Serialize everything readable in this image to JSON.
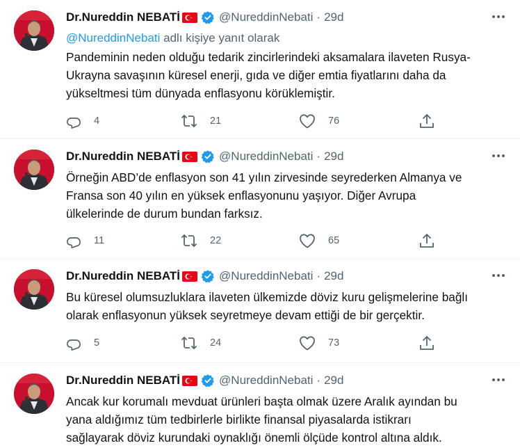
{
  "tweets": [
    {
      "author": "Dr.Nureddin NEBATİ",
      "handle": "@NureddinNebati",
      "separator": "·",
      "time": "29d",
      "reply_prefix": "@NureddinNebati",
      "reply_suffix": " adlı kişiye yanıt olarak",
      "lines": [
        "Pandeminin neden olduğu tedarik zincirlerindeki aksamalara ilaveten Rusya-",
        "Ukrayna savaşının küresel enerji, gıda ve diğer emtia fiyatlarını daha da",
        "yükseltmesi tüm dünyada enflasyonu körüklemiştir."
      ],
      "replies": "4",
      "retweets": "21",
      "likes": "76"
    },
    {
      "author": "Dr.Nureddin NEBATİ",
      "handle": "@NureddinNebati",
      "separator": "·",
      "time": "29d",
      "lines": [
        "Örneğin ABD’de enflasyon son 41 yılın zirvesinde seyrederken Almanya ve",
        "Fransa son 40 yılın en yüksek enflasyonunu yaşıyor. Diğer Avrupa",
        "ülkelerinde de durum bundan farksız."
      ],
      "replies": "11",
      "retweets": "22",
      "likes": "65"
    },
    {
      "author": "Dr.Nureddin NEBATİ",
      "handle": "@NureddinNebati",
      "separator": "·",
      "time": "29d",
      "lines": [
        "Bu küresel olumsuzluklara ilaveten ülkemizde döviz kuru gelişmelerine bağlı",
        "olarak enflasyonun yüksek seyretmeye devam ettiği de bir gerçektir."
      ],
      "replies": "5",
      "retweets": "24",
      "likes": "73"
    },
    {
      "author": "Dr.Nureddin NEBATİ",
      "handle": "@NureddinNebati",
      "separator": "·",
      "time": "29d",
      "lines": [
        "Ancak kur korumalı mevduat ürünleri başta olmak üzere Aralık ayından bu",
        "yana aldığımız tüm tedbirlerle birlikte finansal piyasalarda istikrarı",
        "sağlayarak döviz kurundaki oynaklığı önemli ölçüde kontrol altına aldık."
      ]
    }
  ],
  "icons": {
    "reply": "reply-icon",
    "retweet": "retweet-icon",
    "like": "heart-icon",
    "share": "share-icon",
    "more": "more-icon",
    "verified": "verified-badge-icon",
    "flag": "turkey-flag-icon"
  },
  "colors": {
    "link": "#1d9bf0",
    "secondary_text": "#536471",
    "verified": "#1d9bf0",
    "flag_red": "#e30a17",
    "divider": "#eff3f4"
  }
}
